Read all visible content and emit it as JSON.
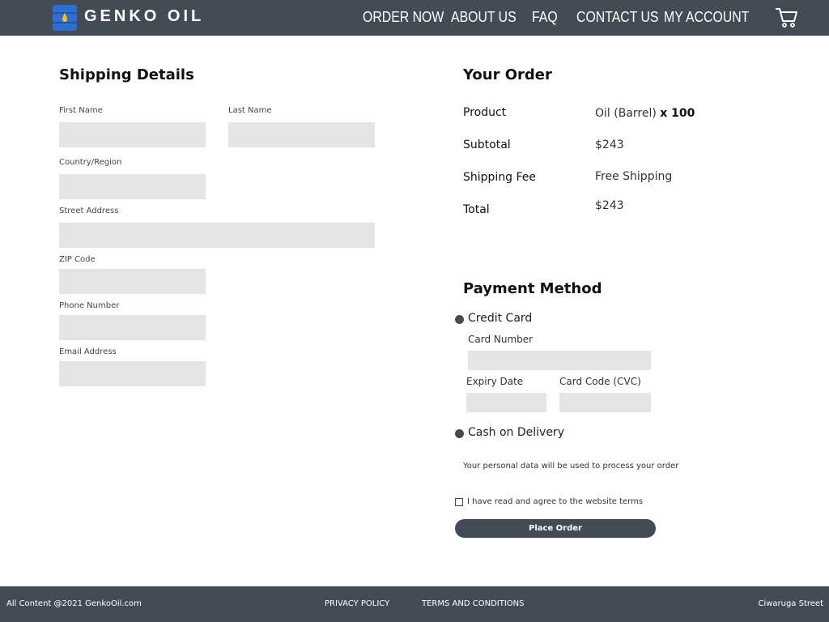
{
  "header": {
    "brand": "GENKO OIL",
    "logo_icon": "oil-barrel-logo-icon",
    "nav": [
      {
        "label": "ORDER NOW"
      },
      {
        "label": "ABOUT US"
      },
      {
        "label": "FAQ"
      },
      {
        "label": "CONTACT US"
      },
      {
        "label": "MY ACCOUNT"
      }
    ],
    "cart_icon": "shopping-cart-icon",
    "bar_color": "#434c55"
  },
  "shipping": {
    "title": "Shipping Details",
    "fields": {
      "first_name": {
        "label": "First Name",
        "value": ""
      },
      "last_name": {
        "label": "Last Name",
        "value": ""
      },
      "country": {
        "label": "Country/Region",
        "value": ""
      },
      "street": {
        "label": "Street Address",
        "value": ""
      },
      "zip": {
        "label": "ZIP Code",
        "value": ""
      },
      "phone": {
        "label": "Phone Number",
        "value": ""
      },
      "email": {
        "label": "Email Address",
        "value": ""
      }
    }
  },
  "order": {
    "title": "Your Order",
    "product_label": "Product",
    "product_name": "Oil (Barrel)",
    "product_qty": "x 100",
    "subtotal_label": "Subtotal",
    "subtotal_value": "$243",
    "shipping_label": "Shipping Fee",
    "shipping_value": "Free Shipping",
    "total_label": "Total",
    "total_value": "$243"
  },
  "payment": {
    "title": "Payment Method",
    "credit_card_label": "Credit Card",
    "card_number_label": "Card Number",
    "expiry_label": "Expiry Date",
    "cvc_label": "Card Code (CVC)",
    "cod_label": "Cash on Delivery",
    "note": "Your personal data will be used to process your order",
    "terms_label": "I have read and agree to the website terms",
    "terms_checked": false,
    "place_order_label": "Place Order"
  },
  "footer": {
    "copyright": "All Content @2021 GenkoOil.com",
    "privacy": "PRIVACY POLICY",
    "terms": "TERMS AND CONDITIONS",
    "address": "Ciwaruga Street"
  }
}
